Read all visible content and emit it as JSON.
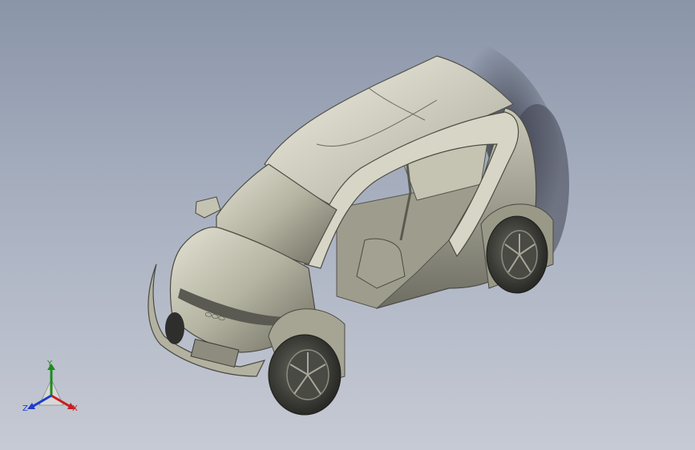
{
  "viewport": {
    "background_top": "#8a95a8",
    "background_bottom": "#c6cad4"
  },
  "model": {
    "name_icon": "electric-microcar-3d-model",
    "body_color": "#b9b8a6",
    "shadow_color": "#3f4250",
    "tire_color": "#2e2f2c"
  },
  "triad": {
    "x_label": "X",
    "y_label": "Y",
    "z_label": "Z",
    "x_color": "#c81e1e",
    "y_color": "#1f8a1f",
    "z_color": "#1e3cc8"
  }
}
